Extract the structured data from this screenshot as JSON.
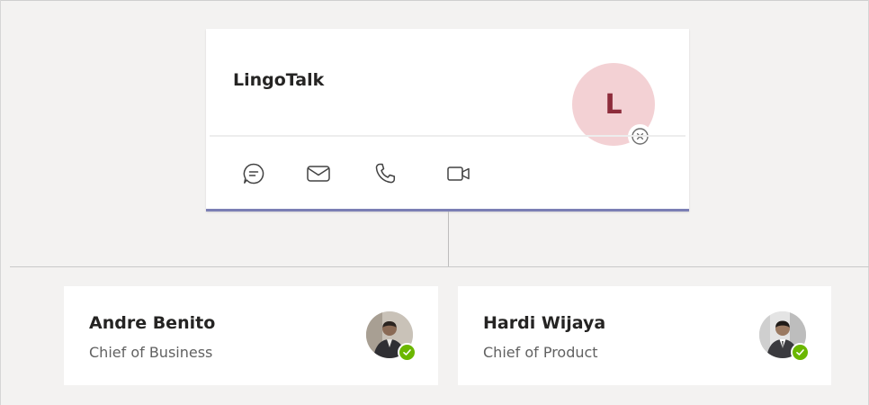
{
  "org": {
    "team_card": {
      "name": "LingoTalk",
      "avatar_initial": "L",
      "avatar_bg": "#f3d1d4",
      "avatar_fg": "#8d2c3b",
      "accent": "#7b7fb5",
      "status_icon": "presence-offline-x-icon",
      "actions": [
        {
          "icon": "chat-icon"
        },
        {
          "icon": "mail-icon"
        },
        {
          "icon": "phone-icon"
        },
        {
          "icon": "video-icon"
        }
      ]
    },
    "reports": [
      {
        "name": "Andre Benito",
        "title": "Chief of Business",
        "presence": "available",
        "presence_color": "#6bb700"
      },
      {
        "name": "Hardi Wijaya",
        "title": "Chief of Product",
        "presence": "available",
        "presence_color": "#6bb700"
      }
    ]
  }
}
